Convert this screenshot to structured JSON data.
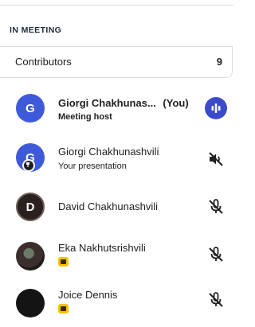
{
  "section_title": "IN MEETING",
  "contributors": {
    "label": "Contributors",
    "count": "9"
  },
  "participants": [
    {
      "name": "Giorgi Chakhunas...",
      "suffix": "(You)",
      "subtitle": "Meeting host",
      "avatar_letter": "G",
      "avatar_color": "#3f5ad8",
      "status": "speaking-indicator"
    },
    {
      "name": "Giorgi Chakhunashvili",
      "subtitle": "Your presentation",
      "avatar_letter": "G",
      "avatar_color": "#3f5ad8",
      "status": "audio-muted-icon"
    },
    {
      "name": "David Chakhunashvili",
      "avatar_letter": "D",
      "avatar_color": "#2a211f",
      "status": "mic-muted-icon"
    },
    {
      "name": "Eka Nakhutsrishvili",
      "avatar_letter": "",
      "status": "mic-muted-icon"
    },
    {
      "name": "Joice Dennis",
      "avatar_letter": "",
      "status": "mic-muted-icon"
    }
  ],
  "colors": {
    "accent": "#3b4bc8",
    "tag": "#f5c400"
  }
}
